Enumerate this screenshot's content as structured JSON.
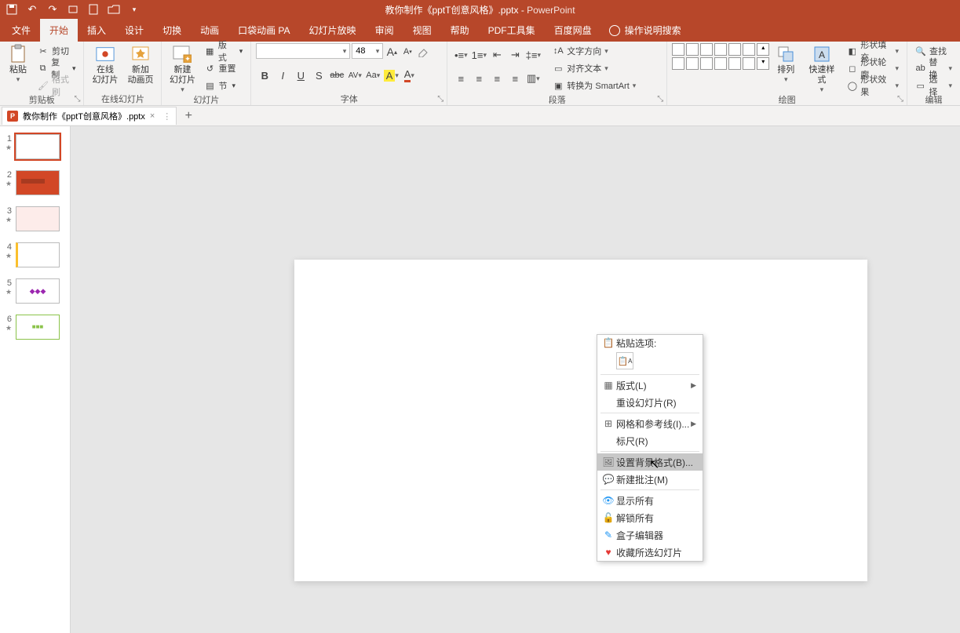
{
  "title": {
    "filename": "教你制作《pptT创意风格》.pptx",
    "separator": " - ",
    "appname": "PowerPoint"
  },
  "qat": {
    "save": "💾",
    "undo": "↶",
    "redo": "↷"
  },
  "tabs": {
    "file": "文件",
    "home": "开始",
    "insert": "插入",
    "design": "设计",
    "transitions": "切换",
    "animations": "动画",
    "pocket": "口袋动画 PA",
    "slideshow": "幻灯片放映",
    "review": "审阅",
    "view": "视图",
    "help": "帮助",
    "pdf": "PDF工具集",
    "baidu": "百度网盘",
    "tellme": "操作说明搜索"
  },
  "ribbon": {
    "clipboard": {
      "paste": "粘贴",
      "cut": "剪切",
      "copy": "复制",
      "formatpainter": "格式刷",
      "label": "剪贴板"
    },
    "onlineSlides": {
      "online": "在线\n幻灯片",
      "newAnim": "新加\n动画页",
      "label": "在线幻灯片"
    },
    "slides": {
      "newslide": "新建\n幻灯片",
      "layout": "版式",
      "reset": "重置",
      "section": "节",
      "label": "幻灯片"
    },
    "font": {
      "name": "",
      "size": "48",
      "grow": "A",
      "shrink": "A",
      "clear": "⌫",
      "bold": "B",
      "italic": "I",
      "underline": "U",
      "shadow": "S",
      "strike": "abc",
      "spacing": "AV",
      "case": "Aa",
      "highlight": "◢",
      "color": "A",
      "label": "字体"
    },
    "paragraph": {
      "textDirection": "文字方向",
      "align": "对齐文本",
      "smartart": "转换为 SmartArt",
      "label": "段落"
    },
    "drawing": {
      "arrange": "排列",
      "quickstyles": "快速样式",
      "fill": "形状填充",
      "outline": "形状轮廓",
      "effects": "形状效果",
      "label": "绘图"
    },
    "editing": {
      "find": "查找",
      "replace": "替换",
      "select": "选择",
      "label": "编辑"
    }
  },
  "docTab": {
    "name": "教你制作《pptT创意风格》.pptx"
  },
  "thumbs": [
    "1",
    "2",
    "3",
    "4",
    "5",
    "6"
  ],
  "contextMenu": {
    "pasteOptions": "粘贴选项:",
    "layout": "版式(L)",
    "resetSlide": "重设幻灯片(R)",
    "gridGuides": "网格和参考线(I)...",
    "ruler": "标尺(R)",
    "formatBackground": "设置背景格式(B)...",
    "newComment": "新建批注(M)",
    "showAll": "显示所有",
    "unlockAll": "解锁所有",
    "boxEditor": "盒子编辑器",
    "collectSlide": "收藏所选幻灯片"
  }
}
